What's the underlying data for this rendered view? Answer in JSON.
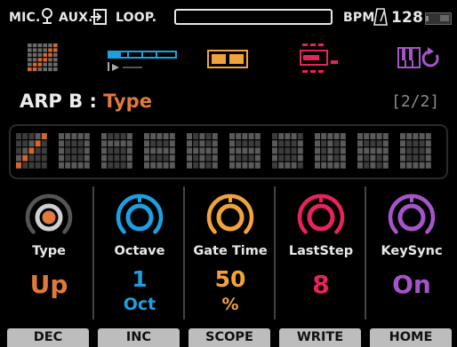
{
  "status": {
    "mic_label": "MIC.",
    "aux_label": "AUX.",
    "loop_label": "LOOP.",
    "bpm_label": "BPM",
    "bpm_value": "128",
    "icons": [
      "microphone-icon",
      "aux-input-icon",
      "metronome-icon",
      "battery-icon"
    ]
  },
  "icon_row": [
    "arp-grid-icon",
    "sequence-timeline-icon",
    "pads-icon",
    "patterns-icon",
    "keyboard-loop-icon"
  ],
  "title": {
    "label": "ARP B : ",
    "value": "Type",
    "page": "[2/2]"
  },
  "knobs": [
    {
      "label": "Type",
      "value": "Up",
      "unit": "",
      "color": "#e07a3c",
      "ring": "#555555"
    },
    {
      "label": "Octave",
      "value": "1",
      "unit": "Oct",
      "color": "#1f9fe0",
      "ring": "#1f9fe0"
    },
    {
      "label": "Gate Time",
      "value": "50",
      "unit": "%",
      "color": "#f2a23a",
      "ring": "#f2a23a"
    },
    {
      "label": "LastStep",
      "value": "8",
      "unit": "",
      "color": "#e6245a",
      "ring": "#e6245a"
    },
    {
      "label": "KeySync",
      "value": "On",
      "unit": "",
      "color": "#a555c8",
      "ring": "#a555c8"
    }
  ],
  "buttons": [
    "DEC",
    "INC",
    "SCOPE",
    "WRITE",
    "HOME"
  ],
  "colors": {
    "accent_orange": "#e07a3c",
    "blue": "#1f9fe0",
    "yellow": "#f2a23a",
    "red": "#e6245a",
    "purple": "#a555c8"
  }
}
